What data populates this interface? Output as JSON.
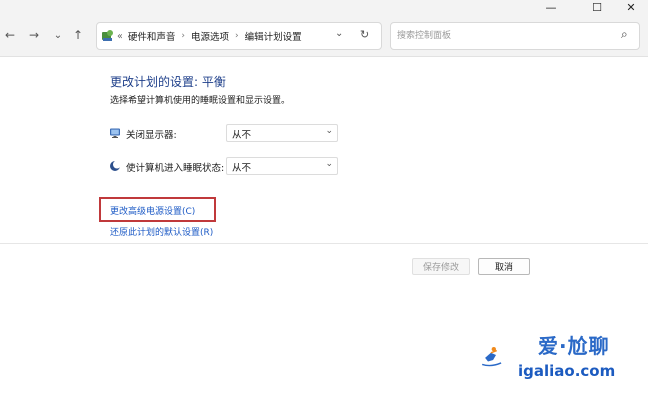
{
  "window": {
    "minimize_glyph": "—",
    "maximize_glyph": "☐",
    "close_glyph": "✕"
  },
  "nav": {
    "back_glyph": "←",
    "forward_glyph": "→",
    "recent_glyph": "⌄",
    "up_glyph": "↑"
  },
  "address": {
    "overflow": "«",
    "breadcrumbs": [
      "硬件和声音",
      "电源选项",
      "编辑计划设置"
    ],
    "separator": "›",
    "dropdown_glyph": "⌄",
    "refresh_glyph": "↻"
  },
  "search": {
    "placeholder": "搜索控制面板",
    "icon_glyph": "⌕"
  },
  "main": {
    "title": "更改计划的设置: 平衡",
    "subtitle": "选择希望计算机使用的睡眠设置和显示设置。",
    "settings": [
      {
        "label": "关闭显示器:",
        "value": "从不"
      },
      {
        "label": "使计算机进入睡眠状态:",
        "value": "从不"
      }
    ],
    "links": {
      "advanced": "更改高级电源设置(C)",
      "restore": "还原此计划的默认设置(R)"
    }
  },
  "footer": {
    "save": "保存修改",
    "cancel": "取消"
  },
  "watermark": {
    "line1": "爱·尬聊",
    "line2": "igaliao.com"
  },
  "colors": {
    "title_blue": "#1e3f8a",
    "link_blue": "#1e5bc6",
    "highlight_red": "#c0393b",
    "watermark_blue": "#2a69c7",
    "watermark_orange": "#f08a1c"
  }
}
